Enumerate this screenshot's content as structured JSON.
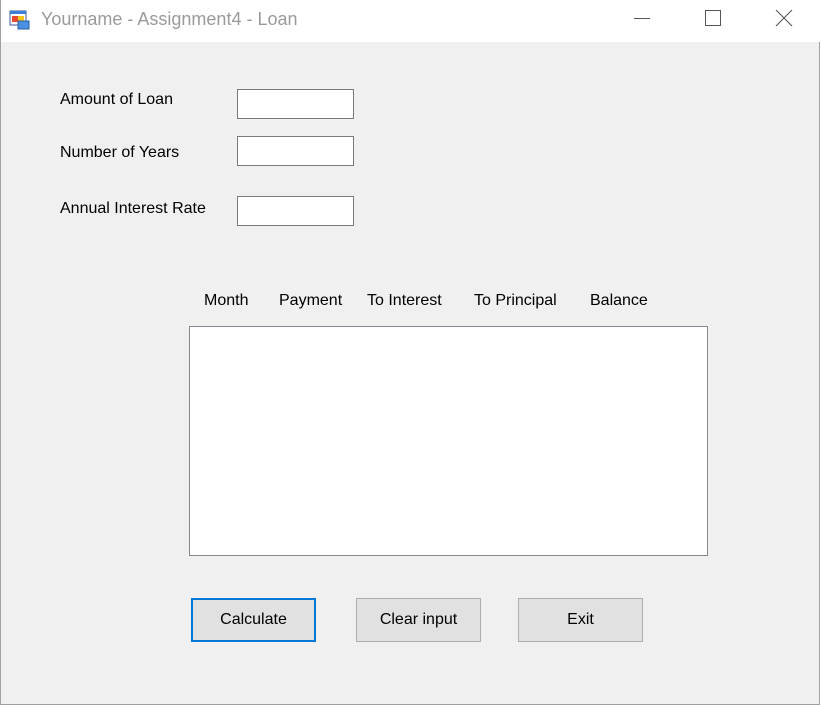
{
  "window": {
    "title": "Yourname - Assignment4 - Loan",
    "icon": "winforms-app-icon",
    "controls": [
      "minimize-icon",
      "maximize-icon",
      "close-icon"
    ]
  },
  "form": {
    "fields": [
      {
        "label": "Amount of Loan",
        "value": ""
      },
      {
        "label": "Number of Years",
        "value": ""
      },
      {
        "label": "Annual Interest Rate",
        "value": ""
      }
    ],
    "columns": [
      "Month",
      "Payment",
      "To Interest",
      "To Principal",
      "Balance"
    ],
    "results": [],
    "buttons": {
      "calculate": "Calculate",
      "clear": "Clear input",
      "exit": "Exit"
    }
  },
  "colors": {
    "form_bg": "#f0f0f0",
    "focus_border": "#0078d7",
    "button_bg": "#e1e1e1"
  }
}
